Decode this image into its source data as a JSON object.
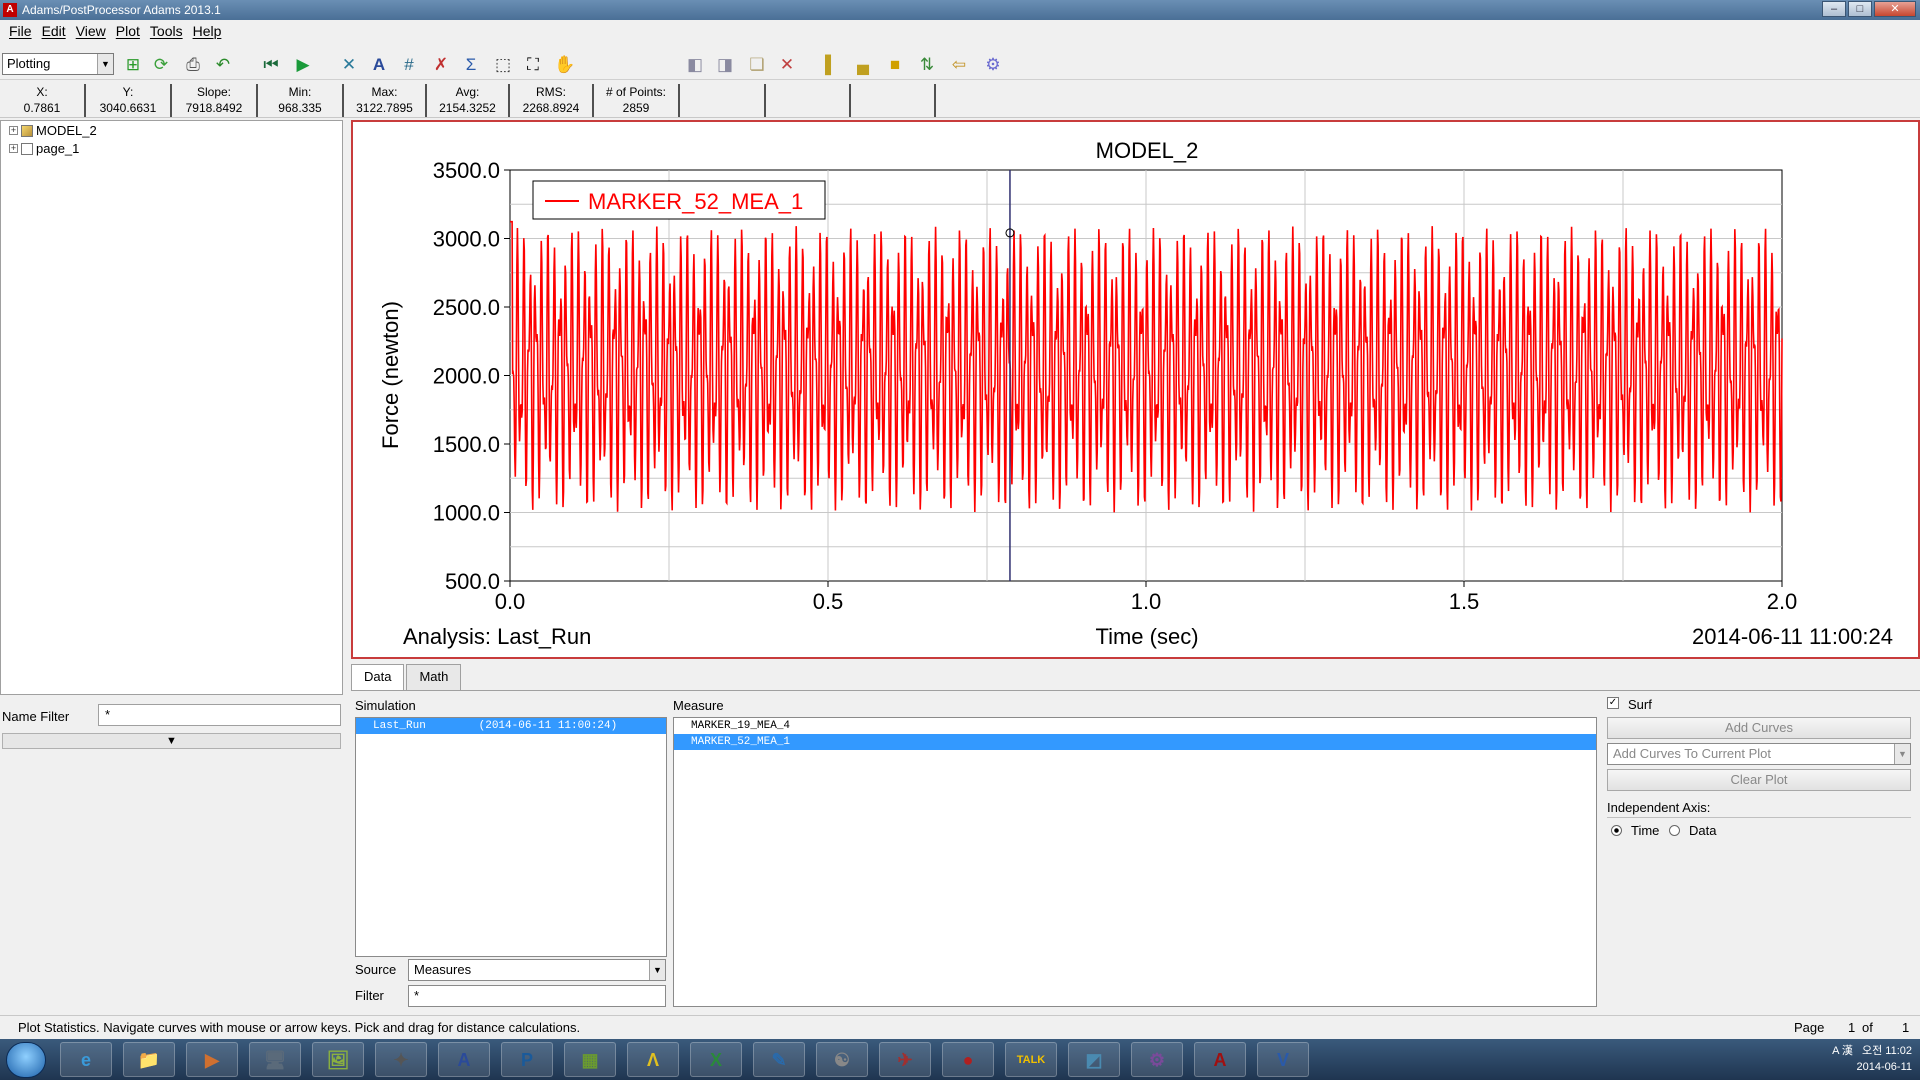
{
  "window": {
    "title": "Adams/PostProcessor Adams 2013.1",
    "app_badge": "A",
    "min": "–",
    "max": "□",
    "close": "✕"
  },
  "menu": [
    "File",
    "Edit",
    "View",
    "Plot",
    "Tools",
    "Help"
  ],
  "toolbar": {
    "mode": "Plotting",
    "arrow": "▼"
  },
  "stats": [
    {
      "label": "X:",
      "value": "0.7861"
    },
    {
      "label": "Y:",
      "value": "3040.6631"
    },
    {
      "label": "Slope:",
      "value": "7918.8492"
    },
    {
      "label": "Min:",
      "value": "968.335"
    },
    {
      "label": "Max:",
      "value": "3122.7895"
    },
    {
      "label": "Avg:",
      "value": "2154.3252"
    },
    {
      "label": "RMS:",
      "value": "2268.8924"
    },
    {
      "label": "# of Points:",
      "value": "2859"
    }
  ],
  "tree": {
    "plus": "+",
    "items": [
      {
        "label": "MODEL_2"
      },
      {
        "label": "page_1"
      }
    ]
  },
  "name_filter": {
    "label": "Name Filter",
    "value": "*",
    "collapse": "▼"
  },
  "chart_data": {
    "type": "line",
    "title": "MODEL_2",
    "xlabel": "Time (sec)",
    "ylabel": "Force (newton)",
    "xlim": [
      0.0,
      2.0
    ],
    "ylim": [
      500.0,
      3500.0
    ],
    "xticks": [
      "0.0",
      "0.5",
      "1.0",
      "1.5",
      "2.0"
    ],
    "yticks": [
      "500.0",
      "1000.0",
      "1500.0",
      "2000.0",
      "2500.0",
      "3000.0",
      "3500.0"
    ],
    "grid": true,
    "legend_position": "top-left",
    "series": [
      {
        "name": "MARKER_52_MEA_1",
        "color": "#ff0000",
        "min": 968.335,
        "max": 3122.7895,
        "points": 2859
      }
    ],
    "cursor_x": 0.7861,
    "cursor_y": 3040.6631,
    "analysis_label": "Analysis:  Last_Run",
    "timestamp": "2014-06-11 11:00:24"
  },
  "tabs": [
    "Data",
    "Math"
  ],
  "simulation": {
    "label": "Simulation",
    "rows": [
      "Last_Run        (2014-06-11 11:00:24)"
    ]
  },
  "measure": {
    "label": "Measure",
    "rows": [
      "MARKER_19_MEA_4",
      "MARKER_52_MEA_1"
    ]
  },
  "source": {
    "label": "Source",
    "value": "Measures",
    "arrow": "▼"
  },
  "filter": {
    "label": "Filter",
    "value": "*"
  },
  "options": {
    "surf_label": "Surf",
    "surf_check": "✓",
    "add_curves": "Add Curves",
    "add_mode": "Add Curves To Current Plot",
    "clear_plot": "Clear Plot",
    "independent_axis": "Independent Axis:",
    "axis_options": [
      "Time",
      "Data"
    ]
  },
  "status": {
    "message": "Plot Statistics.  Navigate curves with mouse or arrow keys.  Pick and drag for distance calculations.",
    "page_label": "Page",
    "page_current": "1",
    "page_of": "of",
    "page_total": "1"
  },
  "taskbar": {
    "apps": [
      "e",
      "📁",
      "▶",
      "🖥",
      "🖼",
      "✦",
      "A",
      "P",
      "▦",
      "Λ",
      "X",
      "✎",
      "☯",
      "✈",
      "●",
      "TALK",
      "◩",
      "⚙",
      "A",
      "V"
    ],
    "time": "오전 11:02",
    "date": "2014-06-11",
    "ime": "A 漢"
  },
  "colors": {
    "curve": "#ff0000",
    "plot_border": "#c83c3c",
    "selection": "#3399ff"
  }
}
